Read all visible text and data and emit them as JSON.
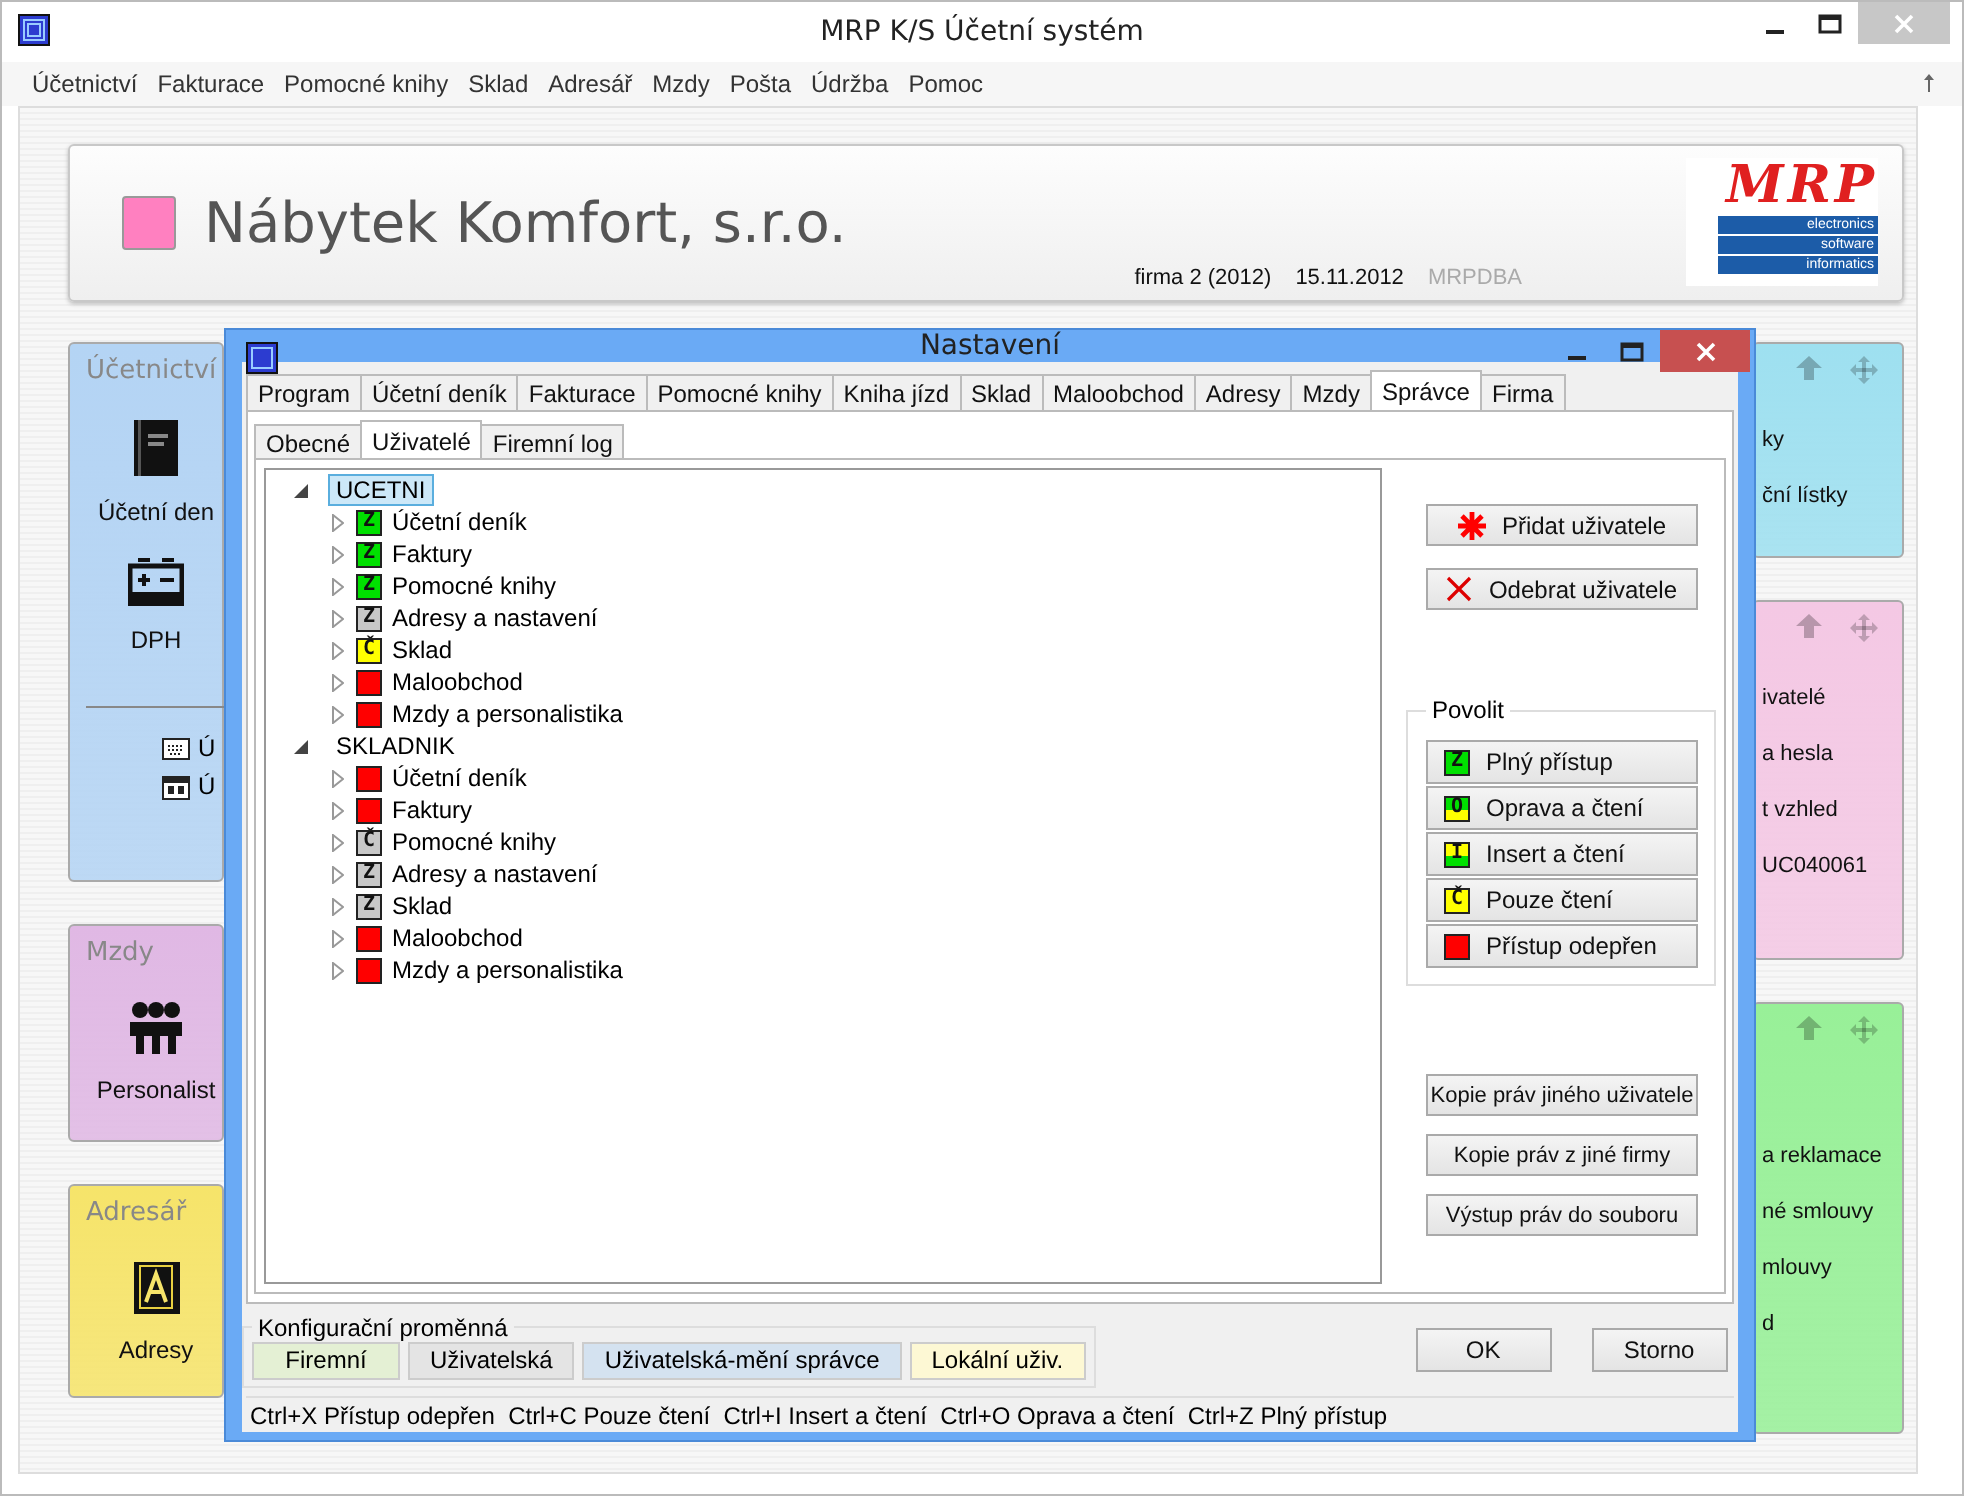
{
  "app": {
    "title": "MRP K/S Účetní systém"
  },
  "menu": [
    "Účetnictví",
    "Fakturace",
    "Pomocné knihy",
    "Sklad",
    "Adresář",
    "Mzdy",
    "Pošta",
    "Údržba",
    "Pomoc"
  ],
  "company": {
    "name": "Nábytek Komfort, s.r.o.",
    "firm": "firma 2 (2012)",
    "date": "15.11.2012",
    "user": "MRPDBA"
  },
  "logo": {
    "name": "MRP",
    "lines": [
      "electronics",
      "software",
      "informatics"
    ]
  },
  "tiles_left": [
    {
      "title": "Účetnictví",
      "color": "#b4d4f4",
      "items": [
        {
          "kind": "big",
          "label": "Účetní den"
        },
        {
          "kind": "big",
          "label": "DPH"
        },
        {
          "kind": "small",
          "label": "Ú"
        },
        {
          "kind": "small",
          "label": "Ú"
        }
      ]
    },
    {
      "title": "Mzdy",
      "color": "#e0b8e4",
      "items": [
        {
          "kind": "big",
          "label": "Personalist"
        }
      ]
    },
    {
      "title": "Adresář",
      "color": "#f6e46a",
      "items": [
        {
          "kind": "big",
          "label": "Adresy"
        }
      ]
    }
  ],
  "tiles_right": [
    {
      "color": "#9ee0f0",
      "items": [
        "ky",
        "ční lístky"
      ]
    },
    {
      "color": "#f4c8e4",
      "items": [
        "ivatelé",
        "a hesla",
        "t vzhled",
        "UC040061"
      ]
    },
    {
      "color": "#98f098",
      "items": [
        "a reklamace",
        "né smlouvy",
        "mlouvy",
        "d"
      ]
    }
  ],
  "dialog": {
    "title": "Nastavení",
    "tabs": [
      {
        "label": "Program",
        "selected": false
      },
      {
        "label": "Účetní deník",
        "selected": false
      },
      {
        "label": "Fakturace",
        "selected": false
      },
      {
        "label": "Pomocné knihy",
        "selected": false
      },
      {
        "label": "Kniha jízd",
        "selected": false
      },
      {
        "label": "Sklad",
        "selected": false
      },
      {
        "label": "Maloobchod",
        "selected": false
      },
      {
        "label": "Adresy",
        "selected": false
      },
      {
        "label": "Mzdy",
        "selected": false
      },
      {
        "label": "Správce",
        "selected": true
      },
      {
        "label": "Firma",
        "selected": false
      }
    ],
    "subtabs": [
      {
        "label": "Obecné",
        "selected": false
      },
      {
        "label": "Uživatelé",
        "selected": true
      },
      {
        "label": "Firemní log",
        "selected": false
      }
    ],
    "users": [
      {
        "name": "UCETNI",
        "selected": true,
        "expanded": true,
        "children": [
          {
            "label": "Účetní deník",
            "badge": "Z",
            "color": "#00e000"
          },
          {
            "label": "Faktury",
            "badge": "Z",
            "color": "#00e000"
          },
          {
            "label": "Pomocné knihy",
            "badge": "Z",
            "color": "#00e000"
          },
          {
            "label": "Adresy a nastavení",
            "badge": "Z",
            "color": "#c8c8c8"
          },
          {
            "label": "Sklad",
            "badge": "Č",
            "color": "#ffff00"
          },
          {
            "label": "Maloobchod",
            "color": "#ff0000"
          },
          {
            "label": "Mzdy a personalistika",
            "color": "#ff0000"
          }
        ]
      },
      {
        "name": "SKLADNIK",
        "selected": false,
        "expanded": true,
        "children": [
          {
            "label": "Účetní deník",
            "color": "#ff0000"
          },
          {
            "label": "Faktury",
            "color": "#ff0000"
          },
          {
            "label": "Pomocné knihy",
            "badge": "Č",
            "color": "#c8c8c8"
          },
          {
            "label": "Adresy a nastavení",
            "badge": "Z",
            "color": "#c8c8c8"
          },
          {
            "label": "Sklad",
            "badge": "Z",
            "color": "#c8c8c8"
          },
          {
            "label": "Maloobchod",
            "color": "#ff0000"
          },
          {
            "label": "Mzdy a personalistika",
            "color": "#ff0000"
          }
        ]
      }
    ],
    "user_buttons": [
      {
        "kind": "add",
        "label": "Přidat uživatele"
      },
      {
        "kind": "remove",
        "label": "Odebrat uživatele"
      }
    ],
    "allow": {
      "title": "Povolit",
      "buttons": [
        {
          "kind": "full",
          "badge": "Z",
          "label": "Plný přístup"
        },
        {
          "kind": "repair",
          "badge": "O",
          "label": "Oprava a čtení"
        },
        {
          "kind": "insert",
          "badge": "I",
          "label": "Insert a čtení"
        },
        {
          "kind": "read",
          "badge": "Č",
          "label": "Pouze čtení"
        },
        {
          "kind": "deny",
          "label": "Přístup odepřen"
        }
      ]
    },
    "copy_buttons": [
      "Kopie práv jiného uživatele",
      "Kopie práv z jiné firmy",
      "Výstup práv do souboru"
    ],
    "config": {
      "title": "Konfigurační proměnná",
      "buttons": [
        {
          "label": "Firemní",
          "color": "#e4f0d4"
        },
        {
          "label": "Uživatelská",
          "color": "#e4e4e4"
        },
        {
          "label": "Uživatelská-mění správce",
          "color": "#d4e2f0"
        },
        {
          "label": "Lokální uživ.",
          "color": "#fdf8d4"
        }
      ]
    },
    "actions": [
      "OK",
      "Storno"
    ],
    "status": "Ctrl+X Přístup odepřen  Ctrl+C Pouze čtení  Ctrl+I Insert a čtení  Ctrl+O Oprava a čtení  Ctrl+Z Plný přístup"
  }
}
